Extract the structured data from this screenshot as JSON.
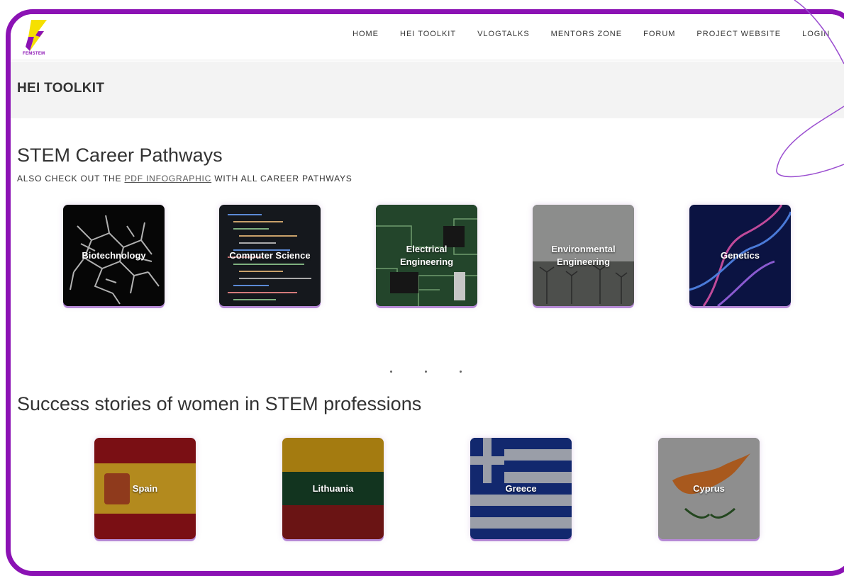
{
  "nav": {
    "logo_text": "FEMSTEM",
    "items": [
      "HOME",
      "HEI TOOLKIT",
      "VLOGTALKS",
      "MENTORS ZONE",
      "FORUM",
      "PROJECT WEBSITE",
      "LOGIN"
    ]
  },
  "page": {
    "title": "HEI TOOLKIT"
  },
  "stem": {
    "title": "STEM Career Pathways",
    "subtitle_before": "ALSO CHECK OUT THE ",
    "subtitle_link": "PDF INFOGRAPHIC",
    "subtitle_after": " WITH ALL CAREER PATHWAYS",
    "cards": [
      "Biotechnology",
      "Computer Science",
      "Electrical Engineering",
      "Environmental Engineering",
      "Genetics"
    ]
  },
  "success": {
    "title": "Success stories of women in STEM professions",
    "cards": [
      "Spain",
      "Lithuania",
      "Greece",
      "Cyprus"
    ]
  },
  "colors": {
    "accent": "#8b12b4",
    "logo_yellow": "#f5e000"
  }
}
